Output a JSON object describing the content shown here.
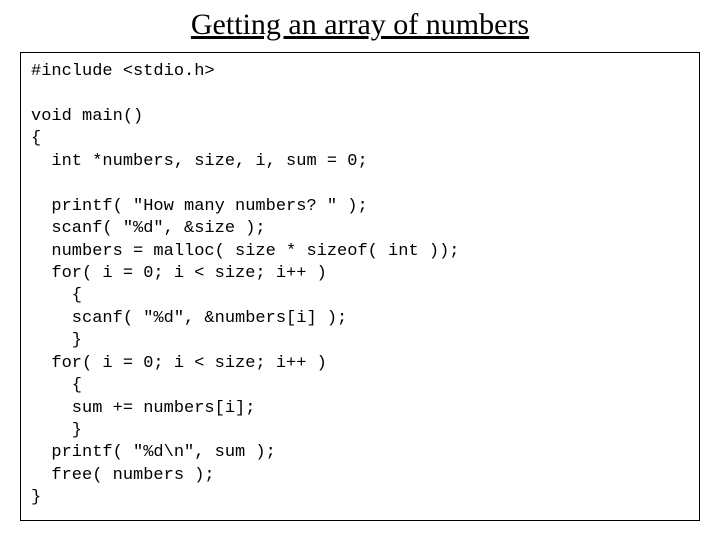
{
  "title": "Getting an array of numbers",
  "code": {
    "l01": "#include <stdio.h>",
    "l02": "",
    "l03": "void main()",
    "l04": "{",
    "l05": "  int *numbers, size, i, sum = 0;",
    "l06": "",
    "l07": "  printf( \"How many numbers? \" );",
    "l08": "  scanf( \"%d\", &size );",
    "l09": "  numbers = malloc( size * sizeof( int ));",
    "l10": "  for( i = 0; i < size; i++ )",
    "l11": "    {",
    "l12": "    scanf( \"%d\", &numbers[i] );",
    "l13": "    }",
    "l14": "  for( i = 0; i < size; i++ )",
    "l15": "    {",
    "l16": "    sum += numbers[i];",
    "l17": "    }",
    "l18": "  printf( \"%d\\n\", sum );",
    "l19": "  free( numbers );",
    "l20": "}"
  }
}
